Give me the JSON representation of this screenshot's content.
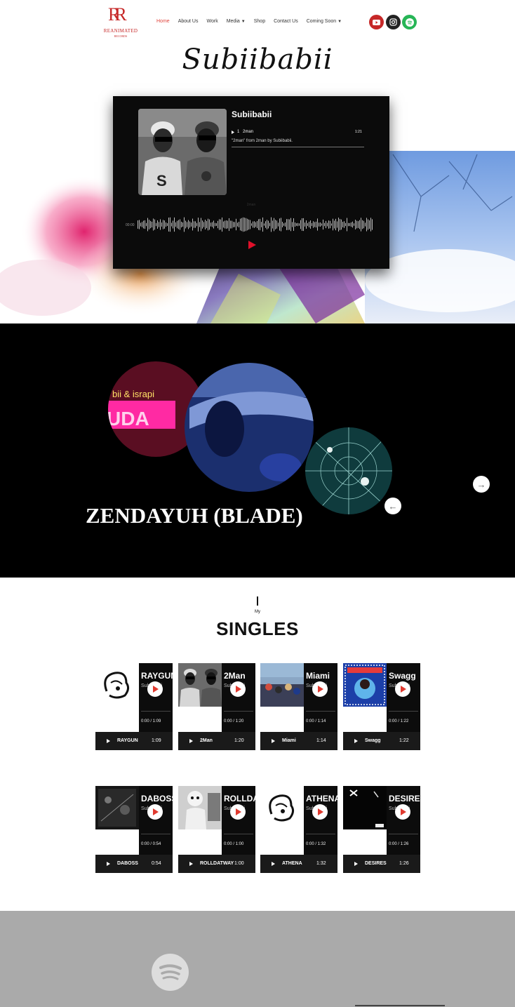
{
  "brand": {
    "logo_mark": "RR",
    "logo_name": "REANIMATED",
    "logo_sub": "RECORDS"
  },
  "nav": {
    "items": [
      {
        "label": "Home",
        "active": true,
        "dropdown": false
      },
      {
        "label": "About Us",
        "active": false,
        "dropdown": false
      },
      {
        "label": "Work",
        "active": false,
        "dropdown": false
      },
      {
        "label": "Media",
        "active": false,
        "dropdown": true
      },
      {
        "label": "Shop",
        "active": false,
        "dropdown": false
      },
      {
        "label": "Contact Us",
        "active": false,
        "dropdown": false
      },
      {
        "label": "Coming Soon",
        "active": false,
        "dropdown": true
      }
    ],
    "social": [
      {
        "icon": "youtube-icon",
        "color": "#c62828"
      },
      {
        "icon": "instagram-icon",
        "color": "#222222"
      },
      {
        "icon": "spotify-icon",
        "color": "#27b556"
      }
    ]
  },
  "hero": {
    "script_title": "Subiibabii",
    "player": {
      "artist": "Subiibabii",
      "track_number": "1",
      "track_name": "2man",
      "track_duration": "1:21",
      "description": "\"2man\" from 2man by Subiibabii.",
      "caption": "2man",
      "current_time": "00:00"
    }
  },
  "carousel": {
    "slide_title": "ZENDAYUH (BLADE)",
    "prev_label": "←",
    "next_label": "→"
  },
  "singles": {
    "kicker": "My",
    "heading": "SINGLES",
    "artist": "Subiibabii",
    "items": [
      {
        "title": "RAYGUN",
        "time_label": "0:00  /  1:09",
        "bar_title": "RAYGUN",
        "duration": "1:09"
      },
      {
        "title": "2Man",
        "time_label": "0:00  /  1:20",
        "bar_title": "2Man",
        "duration": "1:20"
      },
      {
        "title": "Miami",
        "time_label": "0:00  /  1:14",
        "bar_title": "Miami",
        "duration": "1:14"
      },
      {
        "title": "Swagg",
        "time_label": "0:00  /  1:22",
        "bar_title": "Swagg",
        "duration": "1:22"
      },
      {
        "title": "DABOSS",
        "time_label": "0:00  /  0:54",
        "bar_title": "DABOSS",
        "duration": "0:54"
      },
      {
        "title": "ROLLDATWAY",
        "time_label": "0:00  /  1:00",
        "bar_title": "ROLLDATWAY",
        "duration": "1:00"
      },
      {
        "title": "ATHENA",
        "time_label": "0:00  /  1:32",
        "bar_title": "ATHENA",
        "duration": "1:32"
      },
      {
        "title": "DESIRES",
        "time_label": "0:00  /  1:26",
        "bar_title": "DESIRES",
        "duration": "1:26"
      }
    ]
  },
  "colors": {
    "accent": "#e0453d",
    "play_red": "#e0102a",
    "footer_bg": "#aaaaaa"
  }
}
